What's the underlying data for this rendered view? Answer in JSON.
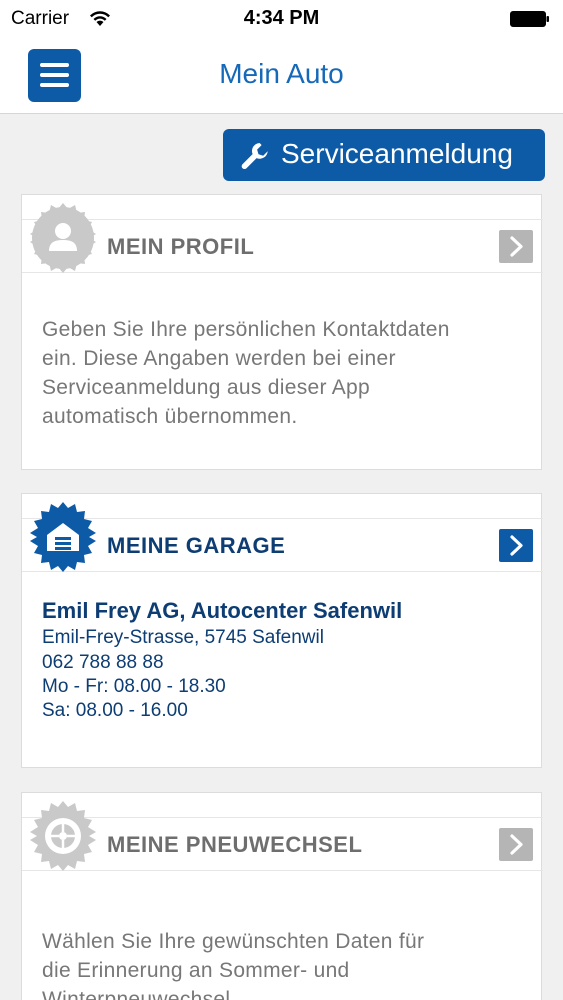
{
  "status_bar": {
    "carrier": "Carrier",
    "time": "4:34 PM",
    "wifi_icon": "wifi-icon",
    "battery_icon": "battery-icon"
  },
  "navbar": {
    "title": "Mein Auto",
    "menu_icon": "hamburger-menu-icon"
  },
  "service_button": {
    "label": "Serviceanmeldung",
    "icon": "wrench-icon"
  },
  "cards": {
    "profile": {
      "title": "MEIN PROFIL",
      "icon": "person-icon",
      "body": "Geben Sie Ihre persönlichen Kontaktdaten ein. Diese Angaben werden bei einer Serviceanmeldung aus dieser App automatisch übernommen.",
      "lines": [
        "Geben Sie Ihre persönlichen Kontaktdaten",
        "ein. Diese Angaben werden bei einer",
        "Serviceanmeldung aus dieser App",
        "automatisch übernommen."
      ]
    },
    "garage": {
      "title": "MEINE GARAGE",
      "icon": "garage-icon",
      "name": "Emil Frey AG, Autocenter Safenwil",
      "address": "Emil-Frey-Strasse, 5745 Safenwil",
      "phone": "062 788 88 88",
      "hours_weekday": "Mo - Fr: 08.00 - 18.30",
      "hours_saturday": "Sa: 08.00 - 16.00"
    },
    "tires": {
      "title": "MEINE PNEUWECHSEL",
      "icon": "tire-icon",
      "lines": [
        "Wählen Sie Ihre gewünschten Daten für",
        "die Erinnerung an Sommer- und",
        "Winterpneuwechsel"
      ]
    }
  },
  "colors": {
    "accent_blue": "#0d5aa7",
    "title_blue": "#1569b8",
    "dark_blue": "#0d3d73",
    "inactive_grey": "#b5b5b5"
  }
}
